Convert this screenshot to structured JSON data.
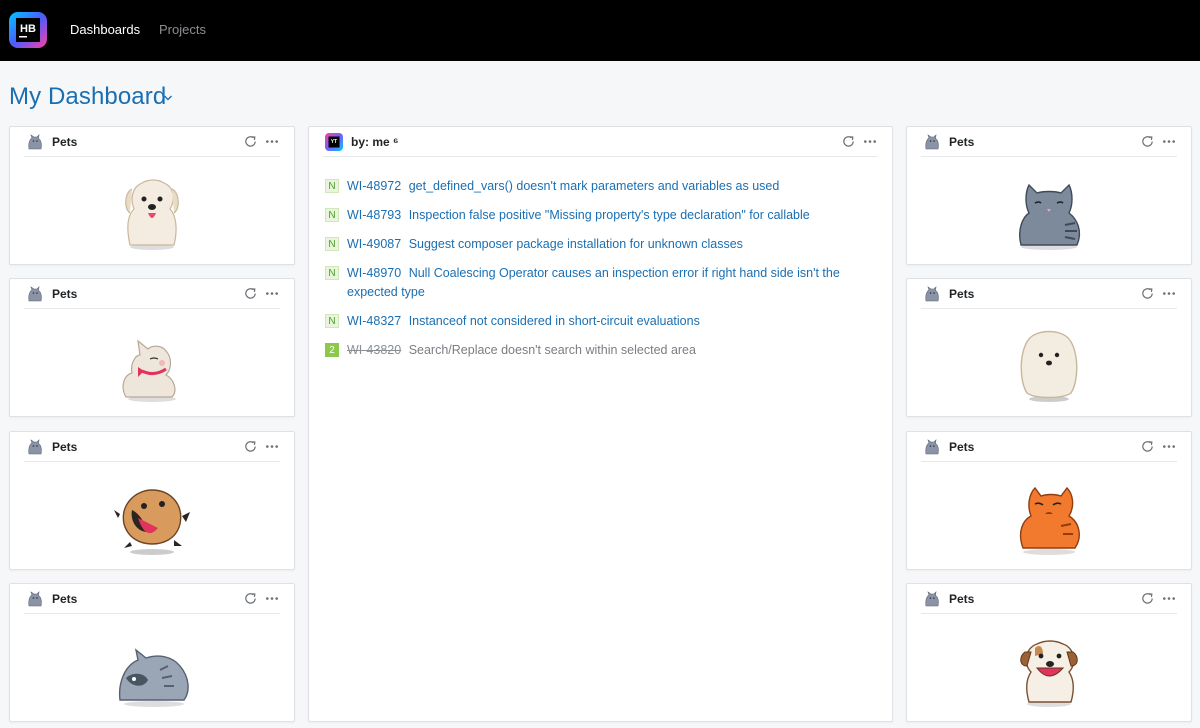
{
  "nav": {
    "logo_text": "HB",
    "items": [
      {
        "label": "Dashboards"
      },
      {
        "label": "Projects"
      }
    ]
  },
  "page": {
    "title": "My Dashboard"
  },
  "pets_widget": {
    "title": "Pets"
  },
  "issues_widget": {
    "title": "by: me ⁶",
    "issues": [
      {
        "badge": "N",
        "id": "WI-48972",
        "summary": "get_defined_vars() doesn't mark parameters and variables as used",
        "resolved": false
      },
      {
        "badge": "N",
        "id": "WI-48793",
        "summary": "Inspection false positive \"Missing property's type declaration\" for callable",
        "resolved": false
      },
      {
        "badge": "N",
        "id": "WI-49087",
        "summary": "Suggest composer package installation for unknown classes",
        "resolved": false
      },
      {
        "badge": "N",
        "id": "WI-48970",
        "summary": "Null Coalescing Operator causes an inspection error if right hand side isn't the expected type",
        "resolved": false
      },
      {
        "badge": "N",
        "id": "WI-48327",
        "summary": "Instanceof not considered in short-circuit evaluations",
        "resolved": false
      },
      {
        "badge": "2",
        "id": "WI-43820",
        "summary": "Search/Replace doesn't search within selected area",
        "resolved": true
      }
    ]
  },
  "colors": {
    "link": "#1a6fb3",
    "badge_new": "#4f9b26",
    "badge_num": "#8cc84b"
  }
}
